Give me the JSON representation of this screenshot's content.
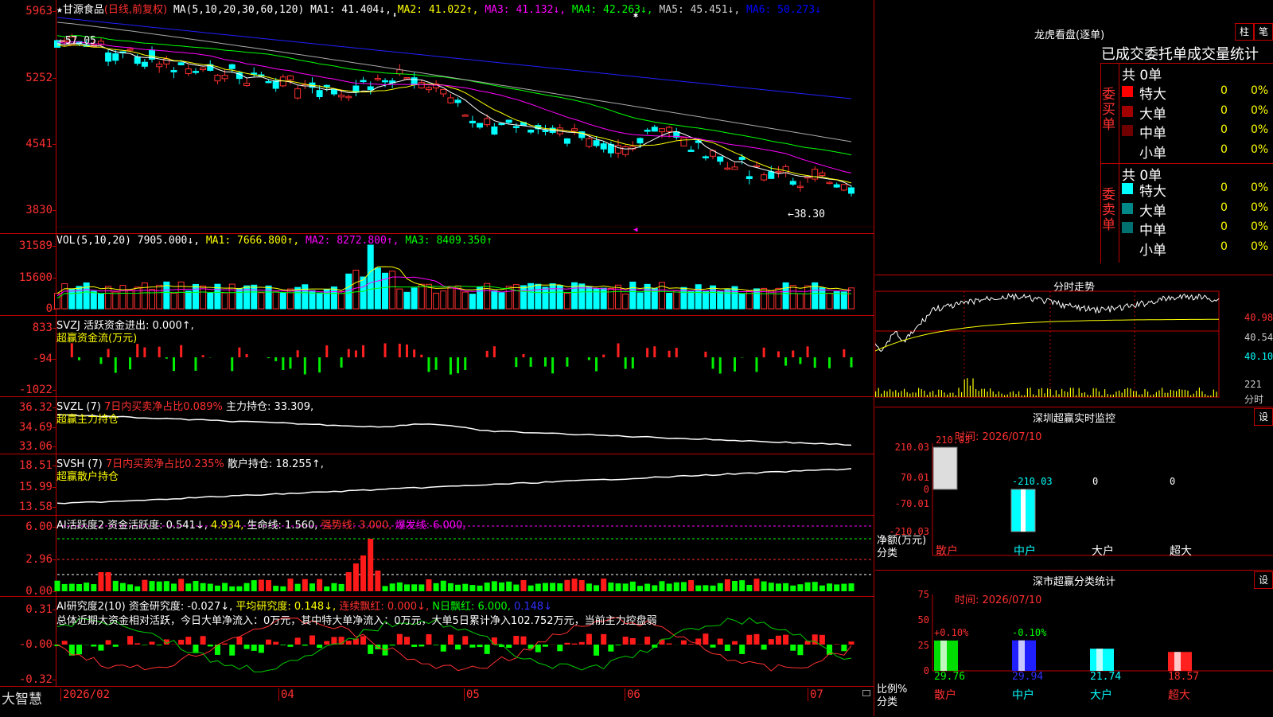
{
  "stock": {
    "star": "★",
    "name": "甘源食品",
    "mode": "(日线,前复权)"
  },
  "main_hdr": {
    "ma_def": "MA(5,10,20,30,60,120)",
    "ma1": "MA1: 41.404↓,",
    "ma2": "MA2: 41.022↑,",
    "ma3": "MA3: 41.132↓,",
    "ma4": "MA4: 42.263↓,",
    "ma5": "MA5: 45.451↓,",
    "ma6": "MA6: 50.273↓"
  },
  "main_axis": [
    "5963",
    "5252",
    "4541",
    "3830"
  ],
  "annot_high": "←57.05",
  "annot_low": "←38.30",
  "vol_hdr": {
    "def": "VOL(5,10,20)",
    "val": "7905.000↓,",
    "ma1": "MA1: 7666.800↑,",
    "ma2": "MA2: 8272.800↑,",
    "ma3": "MA3: 8409.350↑"
  },
  "vol_axis": [
    "31589",
    "15600",
    "0"
  ],
  "svzj": {
    "hdr": "SVZJ  活跃资金进出: 0.000↑,",
    "sub": "超赢资金流(万元)",
    "axis": [
      "833",
      "-94",
      "-1022"
    ]
  },
  "svzl": {
    "hdr1": "SVZL (7)",
    "hdr2": "7日内买卖净占比0.089%",
    "hdr3": "主力持仓: 33.309,",
    "sub": "超赢主力持仓",
    "axis": [
      "36.32",
      "34.69",
      "33.06"
    ]
  },
  "svsh": {
    "hdr1": "SVSH (7)",
    "hdr2": "7日内买卖净占比0.235%",
    "hdr3": "散户持仓: 18.255↑,",
    "sub": "超赢散户持仓",
    "axis": [
      "18.51",
      "15.99",
      "13.58"
    ]
  },
  "ai1": {
    "h1": "AI活跃度2",
    "h2": "资金活跃度: 0.541↓,",
    "h3": "4.934,",
    "h4": "生命线: 1.560,",
    "h5": "强势线: 3.000,",
    "h6": "爆发线: 6.000,",
    "axis": [
      "6.00",
      "2.96",
      "0.00"
    ]
  },
  "ai2": {
    "h1": "AI研究度2(10)",
    "h2": "资金研究度: -0.027↓,",
    "h3": "平均研究度: 0.148↓,",
    "h4": "连续飘红: 0.000↓,",
    "h5": "N日飘红: 6.000,",
    "h6": "0.148↓",
    "desc": "总体近期大资金相对活跃，今日大单净流入：0万元，其中特大单净流入：0万元，大单5日累计净入102.752万元，当前主力控盘弱",
    "axis": [
      "0.31",
      "-0.00",
      "-0.32"
    ]
  },
  "bottom": {
    "brand": "大智慧",
    "dates": [
      "2026/02",
      "04",
      "05",
      "06",
      "07"
    ]
  },
  "lhb": {
    "title": "龙虎看盘(逐单)",
    "btn1": "柱",
    "btn2": "笔",
    "heading": "已成交委托单成交量统计",
    "buy_label": "委买单",
    "sell_label": "委卖单",
    "buy_total": "共 0单",
    "sell_total": "共 0单",
    "buy_rows": [
      {
        "label": "特大",
        "count": "0",
        "pct": "0%",
        "color": "#ff0000"
      },
      {
        "label": "大单",
        "count": "0",
        "pct": "0%",
        "color": "#a00000"
      },
      {
        "label": "中单",
        "count": "0",
        "pct": "0%",
        "color": "#700000"
      },
      {
        "label": "小单",
        "count": "0",
        "pct": "0%",
        "color": "#000000"
      }
    ],
    "sell_rows": [
      {
        "label": "特大",
        "count": "0",
        "pct": "0%",
        "color": "#00ffff"
      },
      {
        "label": "大单",
        "count": "0",
        "pct": "0%",
        "color": "#008888"
      },
      {
        "label": "中单",
        "count": "0",
        "pct": "0%",
        "color": "#007070"
      },
      {
        "label": "小单",
        "count": "0",
        "pct": "0%",
        "color": "#000000"
      }
    ]
  },
  "intraday": {
    "title": "分时走势",
    "prices": [
      "40.98",
      "40.54",
      "40.10"
    ],
    "vol": "221",
    "vol_label": "分时"
  },
  "sz_monitor": {
    "title": "深圳超赢实时监控",
    "btn": "设",
    "time": "时间: 2026/07/10",
    "axis": [
      "210.03",
      "70.01",
      "0",
      "-70.01",
      "-210.03"
    ],
    "values": [
      "210.03",
      "-210.03",
      "0",
      "0"
    ],
    "unit1": "净额(万元)",
    "unit2": "分类",
    "cats": [
      "散户",
      "中户",
      "大户",
      "超大"
    ]
  },
  "sz_class": {
    "title": "深市超赢分类统计",
    "btn": "设",
    "time": "时间: 2026/07/10",
    "axis": [
      "75",
      "50",
      "25",
      "0"
    ],
    "changes": [
      "+0.10%",
      "-0.10%"
    ],
    "values": [
      "29.76",
      "29.94",
      "21.74",
      "18.57"
    ],
    "unit1": "比例%",
    "unit2": "分类",
    "cats": [
      "散户",
      "中户",
      "大户",
      "超大"
    ]
  }
}
